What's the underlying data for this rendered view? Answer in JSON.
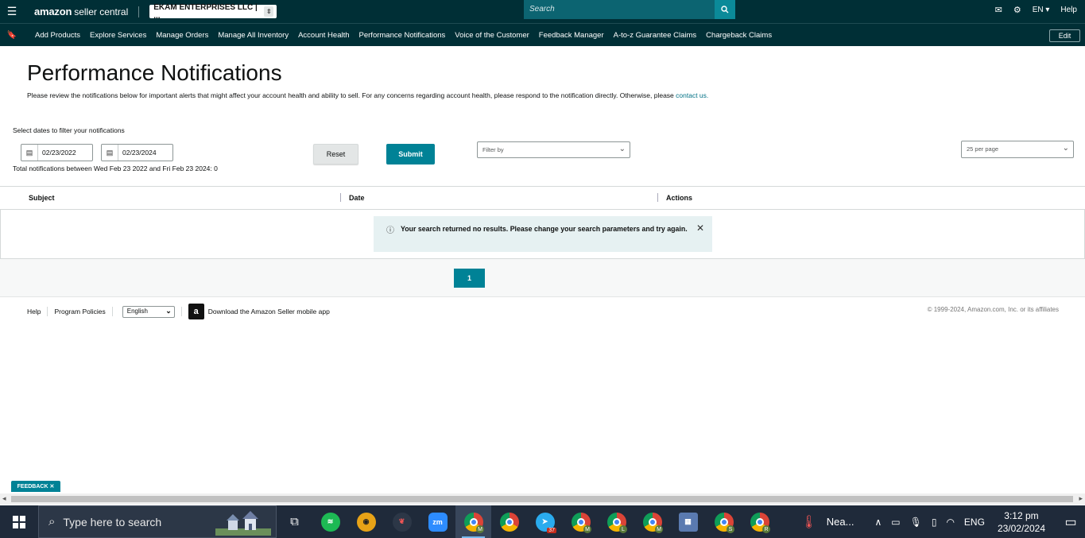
{
  "header": {
    "logo_brand": "amazon",
    "logo_product": "seller central",
    "account_name": "EKAM ENTERPRISES LLC | ...",
    "search_placeholder": "Search",
    "language": "EN ▾",
    "help": "Help"
  },
  "nav": {
    "items": [
      "Add Products",
      "Explore Services",
      "Manage Orders",
      "Manage All Inventory",
      "Account Health",
      "Performance Notifications",
      "Voice of the Customer",
      "Feedback Manager",
      "A-to-z Guarantee Claims",
      "Chargeback Claims"
    ],
    "edit_label": "Edit"
  },
  "page": {
    "title": "Performance Notifications",
    "description": "Please review the notifications below for important alerts that might affect your account health and ability to sell. For any concerns regarding account health, please respond to the notification directly. Otherwise, please",
    "contact_link": "contact us.",
    "filter_label": "Select dates to filter your notifications",
    "date_from": "02/23/2022",
    "date_to": "02/23/2024",
    "total_text": "Total notifications between Wed Feb 23 2022 and Fri Feb 23 2024: 0",
    "reset_label": "Reset",
    "submit_label": "Submit",
    "filter_placeholder": "Filter by",
    "per_page": "25 per page"
  },
  "table": {
    "columns": [
      "Subject",
      "Date",
      "Actions"
    ],
    "empty_message": "Your search returned no results. Please change your search parameters and try again."
  },
  "pagination": {
    "current_page": "1"
  },
  "footer": {
    "help": "Help",
    "program_policies": "Program Policies",
    "language": "English",
    "app_link": "Download the Amazon Seller mobile app",
    "copyright": "© 1999-2024, Amazon.com, Inc. or its affiliates",
    "feedback": "FEEDBACK ✕"
  },
  "taskbar": {
    "search_placeholder": "Type here to search",
    "weather": "Nea...",
    "language": "ENG",
    "time": "3:12 pm",
    "date": "23/02/2024",
    "telegram_badge": "37",
    "chrome_profiles": [
      "M",
      "",
      "M",
      "L",
      "M",
      "S",
      "R"
    ]
  },
  "colors": {
    "header_bg": "#002f36",
    "accent": "#008296",
    "alert_bg": "#e6f1f2"
  }
}
